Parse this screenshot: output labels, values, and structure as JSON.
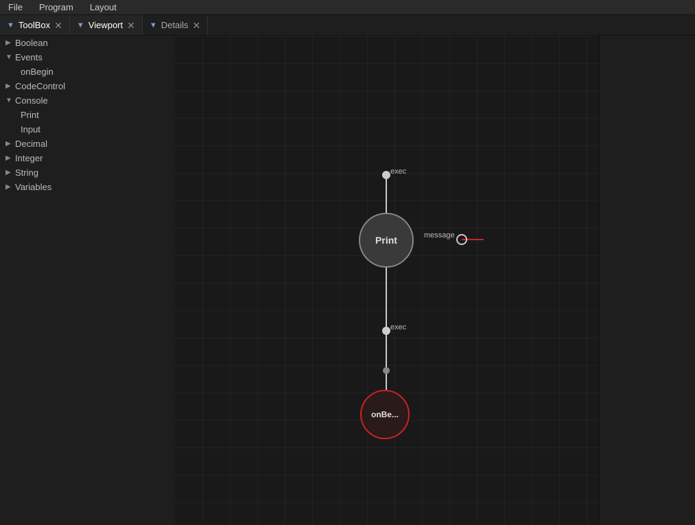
{
  "menubar": {
    "items": [
      {
        "label": "File"
      },
      {
        "label": "Program"
      },
      {
        "label": "Layout"
      }
    ]
  },
  "tabs": [
    {
      "id": "toolbox",
      "label": "ToolBox",
      "active": true,
      "closable": true,
      "icon": "▼"
    },
    {
      "id": "viewport",
      "label": "Viewport",
      "active": true,
      "closable": true,
      "icon": "▼"
    },
    {
      "id": "details",
      "label": "Details",
      "active": false,
      "closable": true,
      "icon": "▼"
    }
  ],
  "sidebar": {
    "title": "ToolBox",
    "tree": [
      {
        "id": "boolean",
        "label": "Boolean",
        "expanded": false,
        "indent": 0
      },
      {
        "id": "events",
        "label": "Events",
        "expanded": true,
        "indent": 0,
        "children": [
          {
            "id": "onBegin",
            "label": "onBegin"
          }
        ]
      },
      {
        "id": "codeControl",
        "label": "CodeControl",
        "expanded": false,
        "indent": 0
      },
      {
        "id": "console",
        "label": "Console",
        "expanded": true,
        "indent": 0,
        "children": [
          {
            "id": "print",
            "label": "Print"
          },
          {
            "id": "input",
            "label": "Input"
          }
        ]
      },
      {
        "id": "decimal",
        "label": "Decimal",
        "expanded": false,
        "indent": 0
      },
      {
        "id": "integer",
        "label": "Integer",
        "expanded": false,
        "indent": 0
      },
      {
        "id": "string",
        "label": "String",
        "expanded": false,
        "indent": 0
      },
      {
        "id": "variables",
        "label": "Variables",
        "expanded": false,
        "indent": 0
      }
    ]
  },
  "nodes": {
    "print": {
      "label": "Print",
      "top_pin_label": "exec",
      "bottom_pin_label": "exec",
      "left_pin_label": "message"
    },
    "onBegin": {
      "label": "onBe..."
    }
  },
  "details": {
    "title": "Details"
  }
}
